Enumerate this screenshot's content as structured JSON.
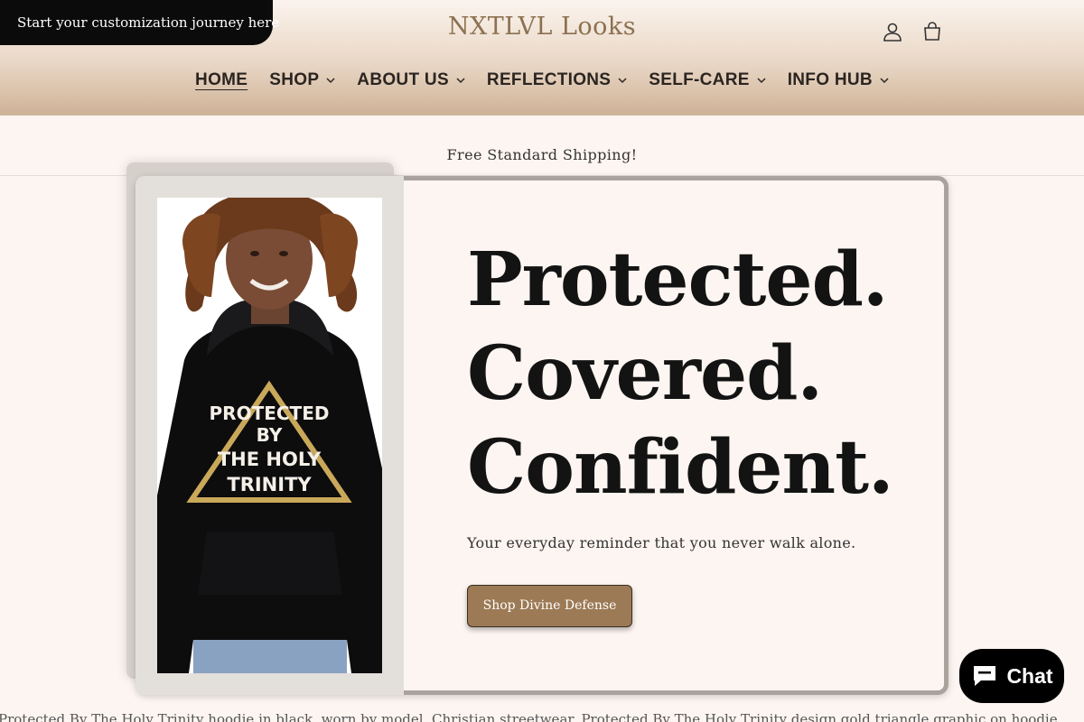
{
  "header": {
    "journey_tab": "Start your customization journey here",
    "brand": "NXTLVL Looks",
    "icons": {
      "account": "account-icon",
      "cart": "cart-icon"
    },
    "nav": [
      {
        "label": "HOME",
        "active": true,
        "dropdown": false
      },
      {
        "label": "SHOP",
        "active": false,
        "dropdown": true
      },
      {
        "label": "ABOUT US",
        "active": false,
        "dropdown": true
      },
      {
        "label": "REFLECTIONS",
        "active": false,
        "dropdown": true
      },
      {
        "label": "SELF-CARE",
        "active": false,
        "dropdown": true
      },
      {
        "label": "INFO HUB",
        "active": false,
        "dropdown": true
      }
    ]
  },
  "announcement": "Free Standard Shipping!",
  "hero": {
    "headline": [
      "Protected.",
      "Covered.",
      "Confident."
    ],
    "subtext": "Your everyday reminder that you never walk alone.",
    "cta_label": "Shop Divine Defense",
    "graphic_text": [
      "PROTECTED",
      "BY",
      "THE HOLY",
      "TRINITY"
    ]
  },
  "caption": "Protected By The Holy Trinity hoodie in black, worn by model. Christian streetwear. Protected By The Holy Trinity design gold triangle graphic on hoodie.",
  "chat": {
    "label": "Chat",
    "icon": "chat-bubble-icon"
  },
  "colors": {
    "brand": "#8c7050",
    "cta_bg": "#9c7a55",
    "page_bg": "#fdf5f1",
    "journey_bg": "#0b0b0b",
    "chat_bg": "#000000"
  }
}
